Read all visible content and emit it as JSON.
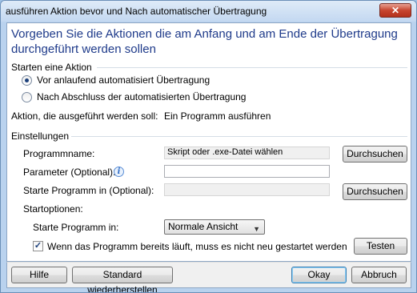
{
  "window": {
    "title": "ausführen Aktion bevor und Nach automatischer Übertragung",
    "close_glyph": "✕"
  },
  "heading": "Vorgeben Sie die Aktionen  die am Anfang und am Ende der Übertragung durchgeführt werden sollen",
  "start_group": {
    "label": "Starten eine Aktion",
    "options": [
      {
        "label": "Vor anlaufend automatisiert Übertragung",
        "checked": true
      },
      {
        "label": "Nach Abschluss der automatisierten Übertragung",
        "checked": false
      }
    ]
  },
  "action": {
    "label": "Aktion, die ausgeführt werden soll:",
    "value": "Ein Programm ausführen"
  },
  "settings": {
    "label": "Einstellungen",
    "program_name_label": "Programmname:",
    "program_name_placeholder": "Skript oder .exe-Datei wählen",
    "parameter_label": "Parameter (Optional):",
    "parameter_value": "",
    "start_in_label": "Starte Programm in (Optional):",
    "start_in_value": "",
    "browse_label": "Durchsuchen",
    "browse_label_2": "Durchsuchen",
    "startoptions_label": "Startoptionen:",
    "start_mode_label": "Starte Programm in:",
    "start_mode_value": "Normale Ansicht",
    "restart_checkbox_label": "Wenn das Programm bereits läuft, muss es nicht neu gestartet werden",
    "restart_checked": true,
    "test_label": "Testen"
  },
  "footer": {
    "help_label": "Hilfe",
    "restore_label": "Standard wiederherstellen",
    "ok_label": "Okay",
    "cancel_label": "Abbruch"
  }
}
